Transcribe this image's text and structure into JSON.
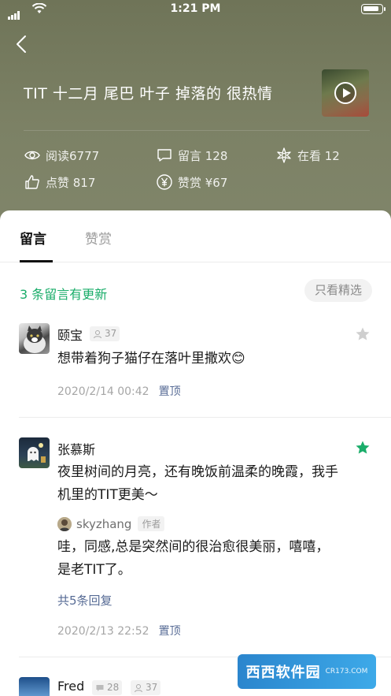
{
  "status_bar": {
    "time": "1:21 PM",
    "battery_level": 0.9
  },
  "article": {
    "title": "TIT 十二月 尾巴 叶子 掉落的 很热情",
    "stats": {
      "reads": "阅读6777",
      "comments": "留言 128",
      "watching": "在看 12",
      "likes": "点赞 817",
      "rewards": "赞赏 ¥67"
    }
  },
  "tabs": [
    {
      "label": "留言",
      "active": true
    },
    {
      "label": "赞赏",
      "active": false
    }
  ],
  "updates_notice": "3 条留言有更新",
  "filter_button": "只看精选",
  "comments": [
    {
      "name": "颐宝",
      "badges": [
        {
          "icon": "person-icon",
          "value": "37"
        }
      ],
      "text": "想带着狗子猫仔在落叶里撒欢😊",
      "date": "2020/2/14  00:42",
      "pin_label": "置顶",
      "starred": false
    },
    {
      "name": "张慕斯",
      "badges": [],
      "text": "夜里树间的月亮，还有晚饭前温柔的晚霞，我手机里的TIT更美～",
      "reply": {
        "name": "skyzhang",
        "tag": "作者",
        "text": "哇，同感,总是突然间的很治愈很美丽，嘻嘻，是老TIT了。"
      },
      "more_replies": "共5条回复",
      "date": "2020/2/13  22:52",
      "pin_label": "置顶",
      "starred": true
    },
    {
      "name": "Fred",
      "badges": [
        {
          "icon": "comment-icon",
          "value": "28"
        },
        {
          "icon": "person-icon",
          "value": "37"
        }
      ],
      "starred": false
    }
  ],
  "watermark": {
    "main": "西西软件园",
    "sub": "CR173.COM"
  },
  "colors": {
    "header": "#7b8063",
    "accent_green": "#1aad6a",
    "link_blue": "#576b95"
  }
}
